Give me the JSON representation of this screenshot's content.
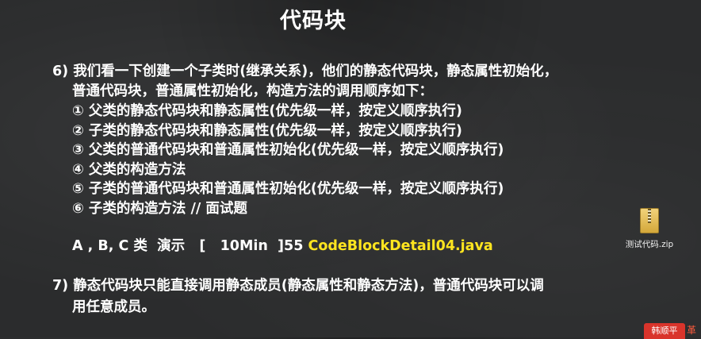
{
  "slide": {
    "title": "代码块",
    "item6": {
      "line1": "6) 我们看一下创建一个子类时(继承关系)，他们的静态代码块，静态属性初始化，",
      "line2": "普通代码块，普通属性初始化，构造方法的调用顺序如下：",
      "steps": [
        "① 父类的静态代码块和静态属性(优先级一样，按定义顺序执行)",
        "② 子类的静态代码块和静态属性(优先级一样，按定义顺序执行)",
        "③ 父类的普通代码块和普通属性初始化(优先级一样，按定义顺序执行)",
        "④ 父类的构造方法",
        "⑤ 子类的普通代码块和普通属性初始化(优先级一样，按定义顺序执行)",
        "⑥ 子类的构造方法 // 面试题"
      ]
    },
    "demo": {
      "prefix": "A , B, C 类  演示   [   10Min  ]55 ",
      "file": "CodeBlockDetail04.java",
      "file_color": "#ffe51f"
    },
    "item7": {
      "line1": "7) 静态代码块只能直接调用静态成员(静态属性和静态方法)，普通代码块可以调",
      "line2": "用任意成员。"
    }
  },
  "desktop_icon": {
    "icon": "zip-archive-icon",
    "label": "测试代码.zip"
  },
  "watermark": {
    "badge": "韩顺平",
    "extra": "革"
  }
}
